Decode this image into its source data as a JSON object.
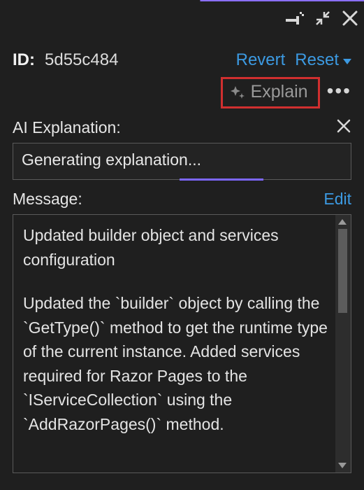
{
  "header": {
    "id_label": "ID:",
    "id_value": "5d55c484",
    "revert": "Revert",
    "reset": "Reset",
    "explain": "Explain"
  },
  "ai_section": {
    "label": "AI Explanation:",
    "status": "Generating explanation..."
  },
  "message_section": {
    "label": "Message:",
    "edit": "Edit",
    "paragraph1": "Updated builder object and services configuration",
    "paragraph2": "Updated the `builder` object by calling the `GetType()` method to get the runtime type of the current instance. Added services required for Razor Pages to the `IServiceCollection` using the `AddRazorPages()` method."
  }
}
